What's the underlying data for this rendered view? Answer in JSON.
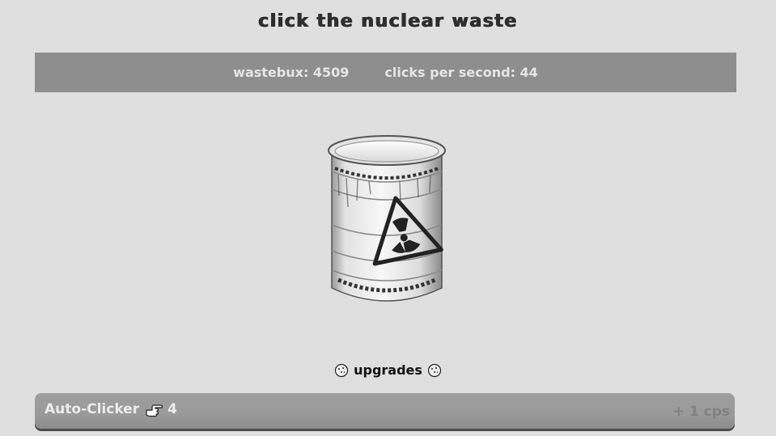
{
  "title": "click the nuclear waste",
  "stats": {
    "wastebux_label": "wastebux: 4509",
    "cps_label": "clicks per second: 44"
  },
  "barrel": {
    "icon": "nuclear-waste-barrel-icon"
  },
  "upgrades": {
    "heading": "upgrades",
    "heading_icon": "cookie-icon",
    "items": [
      {
        "name": "Auto-Clicker",
        "icon": "pointing-hand-icon",
        "count": "4",
        "rate": "+ 1 cps"
      }
    ]
  },
  "colors": {
    "background": "#dfdfdf",
    "stats_bar": "#8e8e8e",
    "upgrade_bar": "#9a9a9a",
    "title_text": "#2e2e2e"
  }
}
